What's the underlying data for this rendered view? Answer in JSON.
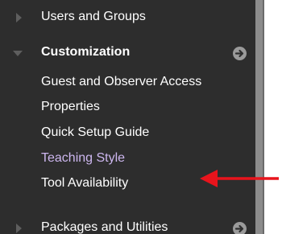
{
  "nav": {
    "items": [
      {
        "label": "Users and Groups"
      },
      {
        "label": "Customization"
      },
      {
        "label": "Guest and Observer Access"
      },
      {
        "label": "Properties"
      },
      {
        "label": "Quick Setup Guide"
      },
      {
        "label": "Teaching Style"
      },
      {
        "label": "Tool Availability"
      },
      {
        "label": "Packages and Utilities"
      }
    ]
  },
  "annotation": {
    "arrow_color": "#e8141c"
  },
  "colors": {
    "panel": "#2d2d2d",
    "visited_link": "#cdb7ef",
    "scrollbar": "#8c8c8c"
  },
  "icons": [
    "expand-right-icon",
    "collapse-down-icon",
    "circle-arrow-icon",
    "red-arrow-icon"
  ]
}
